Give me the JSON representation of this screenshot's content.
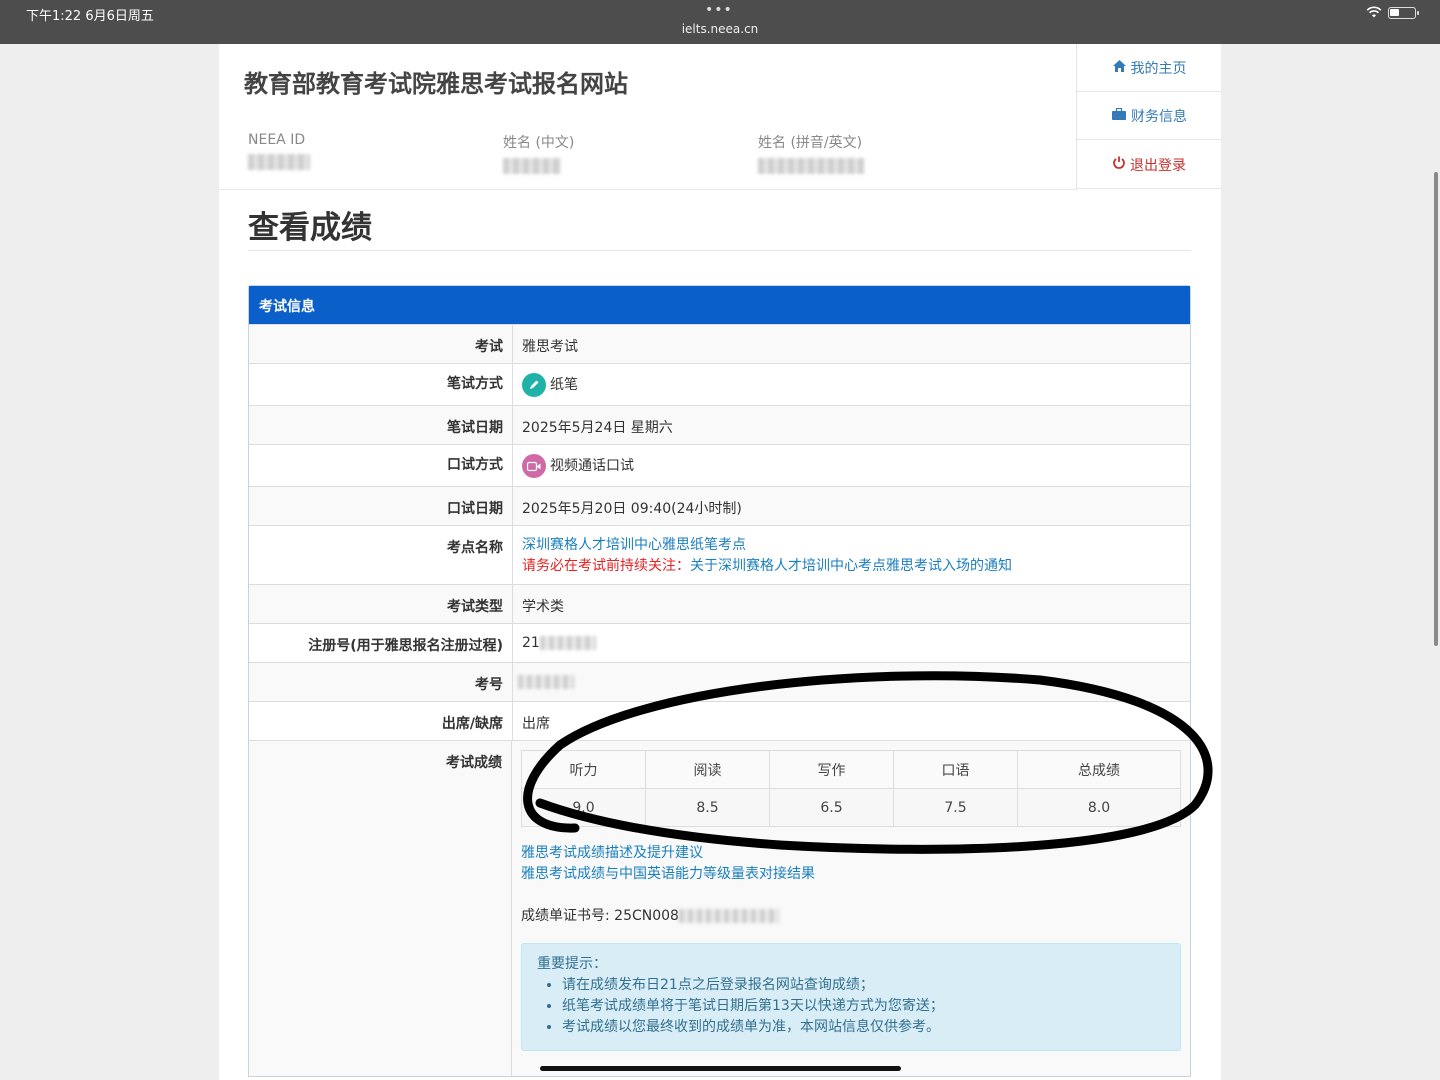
{
  "statusbar": {
    "time": "下午1:22   6月6日周五",
    "url": "ielts.neea.cn",
    "dots": "•••"
  },
  "header": {
    "site_title": "教育部教育考试院雅思考试报名网站",
    "neea_id_label": "NEEA ID",
    "name_cn_label": "姓名 (中文)",
    "name_en_label": "姓名 (拼音/英文)"
  },
  "nav": {
    "home": "我的主页",
    "finance": "财务信息",
    "logout": "退出登录",
    "home_icon": "home-icon",
    "finance_icon": "briefcase-icon",
    "logout_icon": "power-icon"
  },
  "page_heading": "查看成绩",
  "panel_title": "考试信息",
  "rows": {
    "exam": {
      "label": "考试",
      "value": "雅思考试"
    },
    "written_mode": {
      "label": "笔试方式",
      "value": "纸笔"
    },
    "written_date": {
      "label": "笔试日期",
      "value": "2025年5月24日 星期六"
    },
    "speaking_mode": {
      "label": "口试方式",
      "value": "视频通话口试"
    },
    "speaking_date": {
      "label": "口试日期",
      "value": "2025年5月20日 09:40(24小时制)"
    },
    "center": {
      "label": "考点名称",
      "value": "深圳赛格人才培训中心雅思纸笔考点",
      "warn": "请务必在考试前持续关注：",
      "notice_link": "关于深圳赛格人才培训中心考点雅思考试入场的通知"
    },
    "exam_type": {
      "label": "考试类型",
      "value": "学术类"
    },
    "reg_no": {
      "label": "注册号(用于雅思报名注册过程)",
      "value": "21"
    },
    "candidate_no": {
      "label": "考号"
    },
    "attendance": {
      "label": "出席/缺席",
      "value": "出席"
    },
    "result": {
      "label": "考试成绩"
    }
  },
  "scores": {
    "headers": [
      "听力",
      "阅读",
      "写作",
      "口语",
      "总成绩"
    ],
    "values": [
      "9.0",
      "8.5",
      "6.5",
      "7.5",
      "8.0"
    ]
  },
  "links": {
    "desc": "雅思考试成绩描述及提升建议",
    "cse": "雅思考试成绩与中国英语能力等级量表对接结果"
  },
  "trf": {
    "label": "成绩单证书号: 25CN008"
  },
  "notice": {
    "title": "重要提示：",
    "items": [
      "请在成绩发布日21点之后登录报名网站查询成绩；",
      "纸笔考试成绩单将于笔试日期后第13天以快递方式为您寄送；",
      "考试成绩以您最终收到的成绩单为准，本网站信息仅供参考。"
    ]
  },
  "colors": {
    "panel_head": "#0a5fc9",
    "link": "#1a7fbf",
    "warn": "#e52222",
    "notice_bg": "#d9edf7",
    "logout": "#c9302c"
  }
}
